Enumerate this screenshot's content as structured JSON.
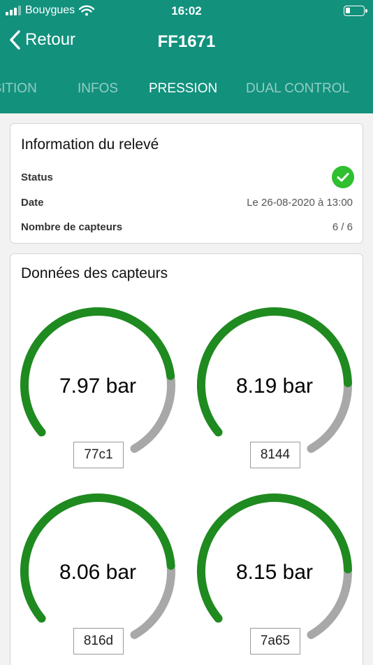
{
  "status_bar": {
    "carrier": "Bouygues",
    "time": "16:02",
    "icons": [
      "signal-icon",
      "wifi-icon",
      "battery-icon"
    ]
  },
  "nav": {
    "back_label": "Retour",
    "title": "FF1671"
  },
  "tabs": [
    {
      "label": "POSITION",
      "active": false
    },
    {
      "label": "INFOS",
      "active": false
    },
    {
      "label": "PRESSION",
      "active": true
    },
    {
      "label": "DUAL CONTROL",
      "active": false
    }
  ],
  "info_card": {
    "title": "Information du relevé",
    "status_label": "Status",
    "status_icon": "check-circle-icon",
    "date_label": "Date",
    "date_value": "Le 26-08-2020 à 13:00",
    "sensor_count_label": "Nombre de capteurs",
    "sensor_count_value": "6 / 6"
  },
  "sensors_card": {
    "title": "Données des capteurs",
    "gauges": [
      {
        "value": "7.97 bar",
        "id": "77c1",
        "fill": 0.76
      },
      {
        "value": "8.19 bar",
        "id": "8144",
        "fill": 0.78
      },
      {
        "value": "8.06 bar",
        "id": "816d",
        "fill": 0.77
      },
      {
        "value": "8.15 bar",
        "id": "7a65",
        "fill": 0.78
      }
    ]
  },
  "colors": {
    "header": "#12917d",
    "gauge_fill": "#1f8a1f",
    "gauge_track": "#a8a8a8",
    "status_ok": "#2fbf2f"
  }
}
